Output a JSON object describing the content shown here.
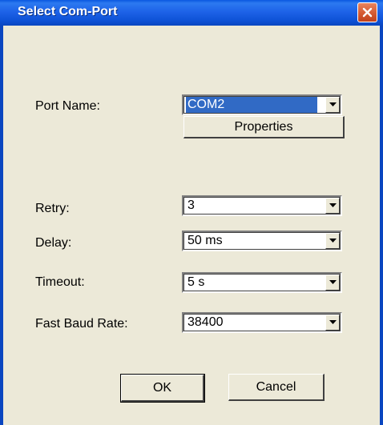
{
  "window": {
    "title": "Select Com-Port"
  },
  "form": {
    "port_name": {
      "label": "Port Name:",
      "value": "COM2"
    },
    "properties_label": "Properties",
    "retry": {
      "label": "Retry:",
      "value": "3"
    },
    "delay": {
      "label": "Delay:",
      "value": "50 ms"
    },
    "timeout": {
      "label": "Timeout:",
      "value": "5 s"
    },
    "fast_baud_rate": {
      "label": "Fast Baud Rate:",
      "value": "38400"
    }
  },
  "buttons": {
    "ok_label": "OK",
    "cancel_label": "Cancel"
  },
  "icons": {
    "close": "close-icon",
    "dropdown": "chevron-down-icon"
  },
  "colors": {
    "titlebar": "#1E63E8",
    "selection": "#316AC5",
    "close_button": "#D55A32",
    "dialog_background": "#ECE9D8"
  }
}
